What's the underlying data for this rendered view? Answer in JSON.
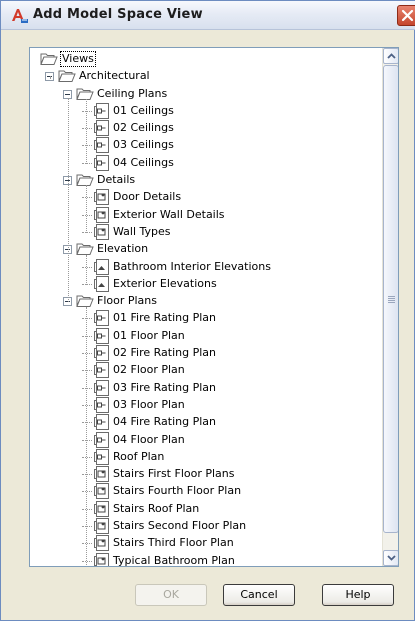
{
  "window": {
    "title": "Add Model Space View",
    "app_icon": "autocad-icon",
    "close_icon": "close-icon"
  },
  "tree": {
    "root": {
      "label": "Views",
      "expanded": true,
      "selected": true
    },
    "nodes": [
      {
        "label": "Architectural",
        "level": 1,
        "type": "folder",
        "expanded": true
      },
      {
        "label": "Ceiling Plans",
        "level": 2,
        "type": "folder",
        "expanded": true
      },
      {
        "label": "01 Ceilings",
        "level": 3,
        "type": "plan-view"
      },
      {
        "label": "02 Ceilings",
        "level": 3,
        "type": "plan-view"
      },
      {
        "label": "03 Ceilings",
        "level": 3,
        "type": "plan-view"
      },
      {
        "label": "04 Ceilings",
        "level": 3,
        "type": "plan-view"
      },
      {
        "label": "Details",
        "level": 2,
        "type": "folder",
        "expanded": true
      },
      {
        "label": "Door Details",
        "level": 3,
        "type": "detail-view"
      },
      {
        "label": "Exterior Wall Details",
        "level": 3,
        "type": "detail-view"
      },
      {
        "label": "Wall Types",
        "level": 3,
        "type": "detail-view"
      },
      {
        "label": "Elevation",
        "level": 2,
        "type": "folder",
        "expanded": true
      },
      {
        "label": "Bathroom Interior Elevations",
        "level": 3,
        "type": "elevation-view"
      },
      {
        "label": "Exterior Elevations",
        "level": 3,
        "type": "elevation-view"
      },
      {
        "label": "Floor Plans",
        "level": 2,
        "type": "folder",
        "expanded": true
      },
      {
        "label": "01 Fire Rating Plan",
        "level": 3,
        "type": "plan-view"
      },
      {
        "label": "01 Floor Plan",
        "level": 3,
        "type": "plan-view"
      },
      {
        "label": "02 Fire Rating Plan",
        "level": 3,
        "type": "plan-view"
      },
      {
        "label": "02 Floor Plan",
        "level": 3,
        "type": "plan-view"
      },
      {
        "label": "03 Fire Rating Plan",
        "level": 3,
        "type": "plan-view"
      },
      {
        "label": "03 Floor Plan",
        "level": 3,
        "type": "plan-view"
      },
      {
        "label": "04 Fire Rating Plan",
        "level": 3,
        "type": "plan-view"
      },
      {
        "label": "04 Floor Plan",
        "level": 3,
        "type": "plan-view"
      },
      {
        "label": "Roof Plan",
        "level": 3,
        "type": "plan-view"
      },
      {
        "label": "Stairs First Floor Plans",
        "level": 3,
        "type": "detail-view"
      },
      {
        "label": "Stairs Fourth Floor Plan",
        "level": 3,
        "type": "detail-view"
      },
      {
        "label": "Stairs Roof Plan",
        "level": 3,
        "type": "detail-view"
      },
      {
        "label": "Stairs Second Floor Plan",
        "level": 3,
        "type": "detail-view"
      },
      {
        "label": "Stairs Third Floor Plan",
        "level": 3,
        "type": "detail-view"
      },
      {
        "label": "Typical Bathroom Plan",
        "level": 3,
        "type": "detail-view"
      }
    ]
  },
  "buttons": {
    "ok_label": "OK",
    "ok_enabled": false,
    "cancel_label": "Cancel",
    "help_label": "Help"
  },
  "colors": {
    "dialog_bg": "#ece9d8",
    "close_button": "#c5462d",
    "selection_outline": "#000000"
  }
}
